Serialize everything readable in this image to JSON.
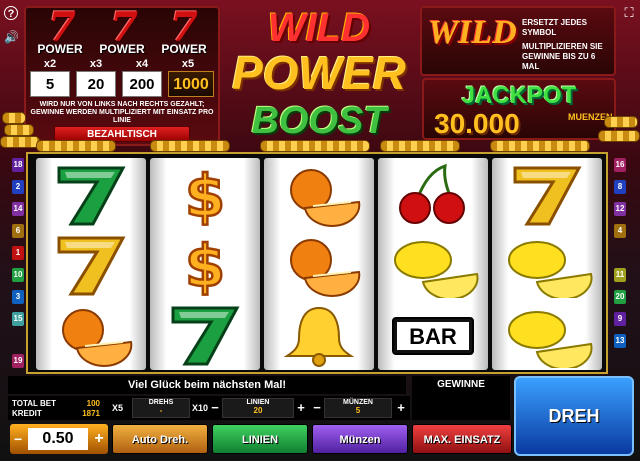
{
  "paytable": {
    "power_labels": [
      "POWER",
      "POWER",
      "POWER"
    ],
    "multipliers": [
      "x2",
      "x3",
      "x4",
      "x5"
    ],
    "values": [
      "5",
      "20",
      "200",
      "1000"
    ],
    "note": "WIRD NUR VON LINKS NACH RECHTS GEZAHLT; GEWINNE WERDEN MULTIPLIZIERT MIT EINSATZ PRO LINIE",
    "button_label": "BEZAHLTISCH"
  },
  "logo": {
    "line1": "WILD",
    "line2": "POWER",
    "line3": "BOOST"
  },
  "wild_info": {
    "word": "WILD",
    "text1": "ERSETZT JEDES SYMBOL",
    "text2": "MULTIPLIZIEREN SIE GEWINNE BIS ZU 6 MAL"
  },
  "jackpot": {
    "title": "JACKPOT",
    "value": "30.000",
    "unit": "MUENZEN"
  },
  "reels": [
    [
      "seven-green",
      "seven-gold",
      "orange"
    ],
    [
      "dollar",
      "dollar",
      "seven-green"
    ],
    [
      "orange",
      "orange",
      "bell"
    ],
    [
      "cherries",
      "lemon",
      "bar"
    ],
    [
      "seven-gold",
      "lemon",
      "lemon"
    ]
  ],
  "bar_text": "BAR",
  "paylines_left": [
    "18",
    "2",
    "14",
    "6",
    "1",
    "10",
    "3",
    "15",
    "19"
  ],
  "paylines_right": [
    "16",
    "8",
    "12",
    "4",
    "11",
    "20",
    "9",
    "13"
  ],
  "message": "Viel Glück beim nächsten Mal!",
  "gewinne_label": "GEWINNE",
  "spin_label": "DREH",
  "stats": {
    "total_bet_label": "TOTAL BET",
    "total_bet_value": "100",
    "kredit_label": "KREDIT",
    "kredit_value": "1871",
    "x5": "X5",
    "x10": "X10",
    "drehs_label": "DREHS",
    "drehs_value": "-",
    "linien_label": "LINIEN",
    "linien_value": "20",
    "muenzen_label": "MÜNZEN",
    "muenzen_value": "5"
  },
  "controls": {
    "stake_value": "0.50",
    "auto_label": "Auto Dreh.",
    "linien_label": "LINIEN",
    "muenzen_label": "Münzen",
    "max_label": "MAX. EINSATZ"
  },
  "colors": {
    "frame_gold": "#c8a030",
    "spin_blue": "#0a3aa0",
    "linien_green": "#18a040",
    "muenzen_purple": "#7030c0",
    "max_red": "#b01010",
    "auto_orange": "#d08020"
  }
}
